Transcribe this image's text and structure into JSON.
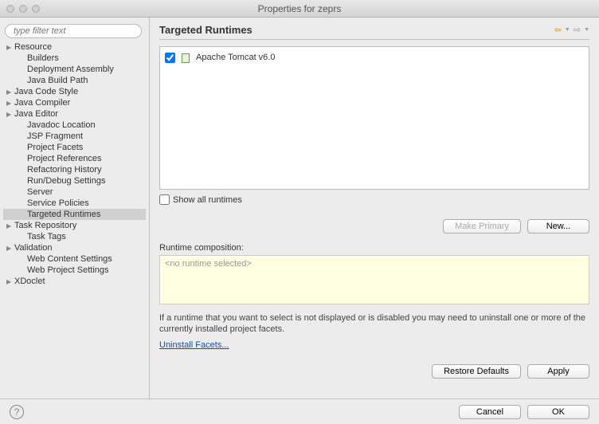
{
  "window": {
    "title": "Properties for zeprs"
  },
  "sidebar": {
    "filter_placeholder": "type filter text",
    "items": [
      {
        "label": "Resource",
        "expandable": true
      },
      {
        "label": "Builders"
      },
      {
        "label": "Deployment Assembly"
      },
      {
        "label": "Java Build Path"
      },
      {
        "label": "Java Code Style",
        "expandable": true
      },
      {
        "label": "Java Compiler",
        "expandable": true
      },
      {
        "label": "Java Editor",
        "expandable": true
      },
      {
        "label": "Javadoc Location"
      },
      {
        "label": "JSP Fragment"
      },
      {
        "label": "Project Facets"
      },
      {
        "label": "Project References"
      },
      {
        "label": "Refactoring History"
      },
      {
        "label": "Run/Debug Settings"
      },
      {
        "label": "Server"
      },
      {
        "label": "Service Policies"
      },
      {
        "label": "Targeted Runtimes",
        "selected": true
      },
      {
        "label": "Task Repository",
        "expandable": true
      },
      {
        "label": "Task Tags"
      },
      {
        "label": "Validation",
        "expandable": true
      },
      {
        "label": "Web Content Settings"
      },
      {
        "label": "Web Project Settings"
      },
      {
        "label": "XDoclet",
        "expandable": true
      }
    ]
  },
  "content": {
    "heading": "Targeted Runtimes",
    "runtimes": [
      {
        "label": "Apache Tomcat v6.0",
        "checked": true
      }
    ],
    "show_all_label": "Show all runtimes",
    "make_primary_label": "Make Primary",
    "new_label": "New...",
    "composition_label": "Runtime composition:",
    "composition_empty": "<no runtime selected>",
    "hint_text": "If a runtime that you want to select is not displayed or is disabled you may need to uninstall one or more of the currently installed project facets.",
    "uninstall_link": "Uninstall Facets...",
    "restore_defaults_label": "Restore Defaults",
    "apply_label": "Apply"
  },
  "footer": {
    "cancel_label": "Cancel",
    "ok_label": "OK"
  }
}
